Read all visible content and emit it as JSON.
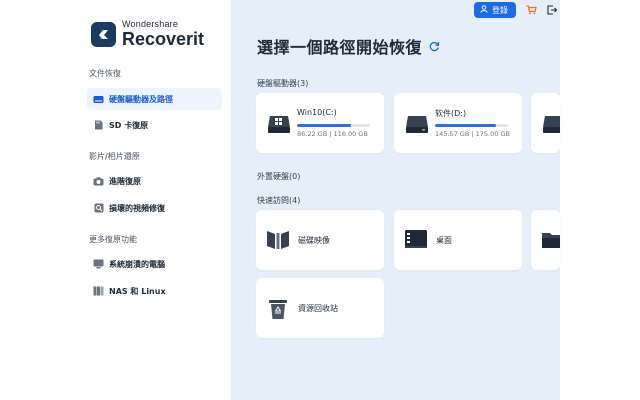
{
  "logo": {
    "brand": "Wondershare",
    "product": "Recoverit"
  },
  "sidebar": {
    "sections": [
      {
        "label": "文件恢復",
        "items": [
          {
            "label": "硬盤驅動器及路徑"
          },
          {
            "label": "SD 卡復原"
          }
        ]
      },
      {
        "label": "影片/相片還原",
        "items": [
          {
            "label": "進階復原"
          },
          {
            "label": "損壞的視頻修復"
          }
        ]
      },
      {
        "label": "更多復原功能",
        "items": [
          {
            "label": "系統崩潰的電腦"
          },
          {
            "label": "NAS 和 Linux"
          }
        ]
      }
    ]
  },
  "header": {
    "login_label": "登錄"
  },
  "main": {
    "title": "選擇一個路徑開始恢復",
    "hard_drives": {
      "label": "硬盤驅動器(3)",
      "drives": [
        {
          "name": "Win10(C:)",
          "size": "86.22 GB | 116.00 GB",
          "usage": 0.74
        },
        {
          "name": "软件(D:)",
          "size": "145.57 GB | 175.00 GB",
          "usage": 0.83
        }
      ]
    },
    "external": {
      "label": "外置硬盤(0)"
    },
    "quick_access": {
      "label": "快速訪問(4)",
      "items": [
        {
          "label": "磁碟映像"
        },
        {
          "label": "桌面"
        },
        {
          "label": "資源回收站"
        }
      ]
    }
  },
  "colors": {
    "accent": "#1d6ae5",
    "main_bg": "#e6eef9",
    "active_bg": "#eef4fd",
    "cart": "#f97316"
  },
  "icons": [
    "logo-icon",
    "hdd-icon",
    "sd-card-icon",
    "camera-icon",
    "video-repair-icon",
    "monitor-icon",
    "nas-icon",
    "user-icon",
    "cart-icon",
    "logout-icon",
    "refresh-icon",
    "windows-drive-icon",
    "drive-icon",
    "disk-image-icon",
    "desktop-icon",
    "folder-icon",
    "recycle-bin-icon"
  ]
}
